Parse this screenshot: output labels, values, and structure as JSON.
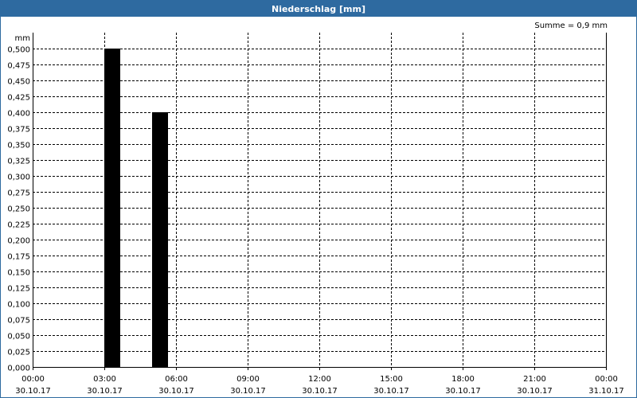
{
  "window": {
    "title": "Niederschlag [mm]"
  },
  "summary": "Summe = 0,9 mm",
  "chart_data": {
    "type": "bar",
    "title": "Niederschlag [mm]",
    "ylabel": "mm",
    "xlabel": "",
    "ylim": [
      0,
      0.5
    ],
    "y_tick_step": 0.025,
    "y_ticks": [
      "0,000",
      "0,025",
      "0,050",
      "0,075",
      "0,100",
      "0,125",
      "0,150",
      "0,175",
      "0,200",
      "0,225",
      "0,250",
      "0,275",
      "0,300",
      "0,325",
      "0,350",
      "0,375",
      "0,400",
      "0,425",
      "0,450",
      "0,475",
      "0,500"
    ],
    "x_range_hours": [
      0,
      24
    ],
    "x_ticks": [
      {
        "time": "00:00",
        "date": "30.10.17"
      },
      {
        "time": "03:00",
        "date": "30.10.17"
      },
      {
        "time": "06:00",
        "date": "30.10.17"
      },
      {
        "time": "09:00",
        "date": "30.10.17"
      },
      {
        "time": "12:00",
        "date": "30.10.17"
      },
      {
        "time": "15:00",
        "date": "30.10.17"
      },
      {
        "time": "18:00",
        "date": "30.10.17"
      },
      {
        "time": "21:00",
        "date": "30.10.17"
      },
      {
        "time": "00:00",
        "date": "31.10.17"
      }
    ],
    "bars": [
      {
        "start": "30.10.17 03:00",
        "end": "30.10.17 03:40",
        "value": 0.5
      },
      {
        "start": "30.10.17 05:00",
        "end": "30.10.17 05:40",
        "value": 0.4
      }
    ],
    "grid": true,
    "bar_color": "#000000"
  }
}
